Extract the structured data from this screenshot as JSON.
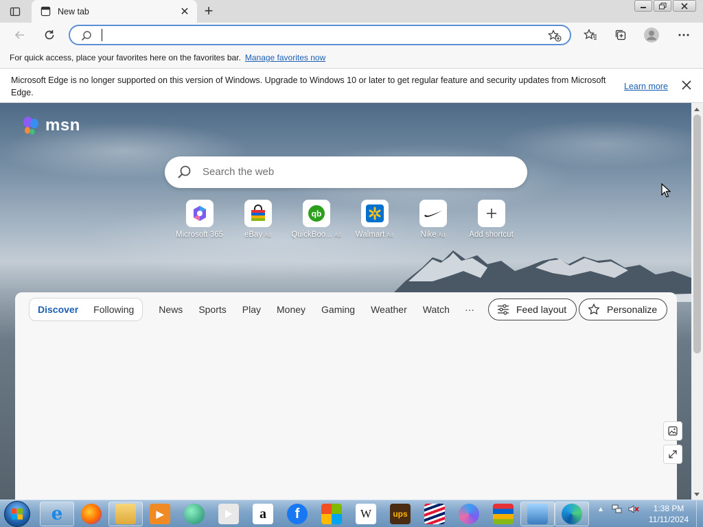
{
  "browser": {
    "tab": {
      "title": "New tab",
      "close_glyph": "✕",
      "favicon": "new-tab-icon"
    },
    "new_tab_glyph": "+",
    "window_controls": [
      "minimize-icon",
      "restore-icon",
      "close-icon"
    ],
    "address": {
      "value": "",
      "placeholder": ""
    }
  },
  "favorites_bar": {
    "text": "For quick access, place your favorites here on the favorites bar.",
    "link": "Manage favorites now"
  },
  "notification": {
    "text": "Microsoft Edge is no longer supported on this version of Windows. Upgrade to Windows 10 or later to get regular feature and security updates from Microsoft Edge.",
    "link": "Learn more"
  },
  "msn": {
    "logo_text": "msn",
    "search_placeholder": "Search the web",
    "ad_tag": "Ad",
    "shortcuts": [
      {
        "label": "Microsoft 365",
        "ad": false,
        "icon": "microsoft-365-icon"
      },
      {
        "label": "eBay",
        "ad": true,
        "icon": "ebay-bag-icon"
      },
      {
        "label": "QuickBoo...",
        "ad": true,
        "icon": "quickbooks-icon"
      },
      {
        "label": "Walmart",
        "ad": true,
        "icon": "walmart-spark-icon"
      },
      {
        "label": "Nike",
        "ad": true,
        "icon": "nike-swoosh-icon"
      },
      {
        "label": "Add shortcut",
        "ad": false,
        "icon": "plus-icon"
      }
    ]
  },
  "feed": {
    "tabs": [
      "Discover",
      "Following"
    ],
    "active_tab": "Discover",
    "nav": [
      "News",
      "Sports",
      "Play",
      "Money",
      "Gaming",
      "Weather",
      "Watch"
    ],
    "more": "···",
    "feed_layout_label": "Feed layout",
    "personalize_label": "Personalize"
  },
  "taskbar": {
    "apps": [
      "internet-explorer-icon",
      "firefox-icon",
      "file-explorer-icon",
      "media-player-icon",
      "copilot-icon",
      "youtube-icon",
      "amazon-icon",
      "facebook-icon",
      "microsoft-store-icon",
      "wikipedia-icon",
      "ups-icon",
      "bank-of-america-icon",
      "microsoft-365-icon",
      "shopping-bag-icon",
      "network-app-icon",
      "edge-icon"
    ],
    "clock": {
      "time": "1:38 PM",
      "date": "11/11/2024"
    }
  },
  "colors": {
    "accent": "#1a5fb4",
    "address_border": "#5b8ed6",
    "tab_bar": "#dcdcdc",
    "taskbar": "#7fa4c8"
  }
}
